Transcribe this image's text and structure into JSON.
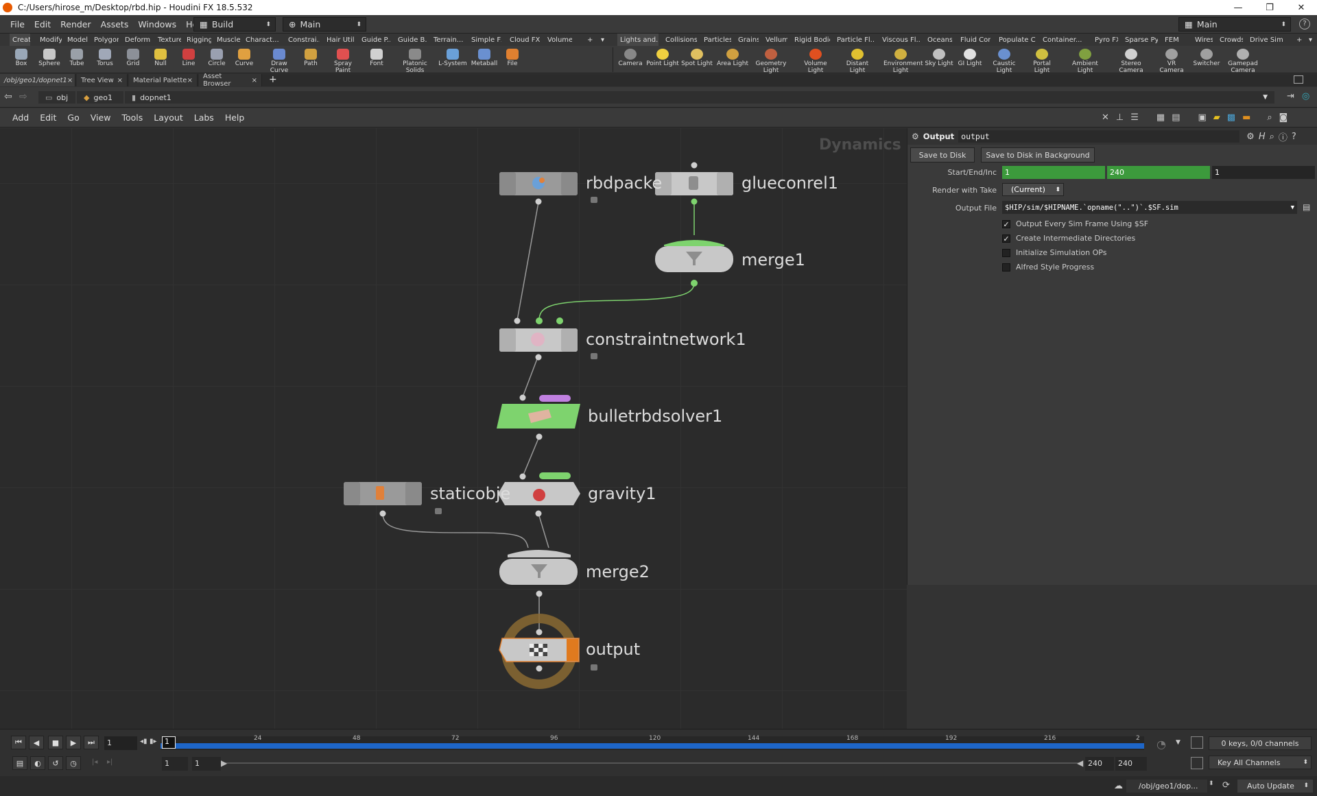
{
  "window": {
    "title": "C:/Users/hirose_m/Desktop/rbd.hip - Houdini FX 18.5.532",
    "minimize": "—",
    "maximize": "❐",
    "close": "✕"
  },
  "menubar": {
    "items": [
      "File",
      "Edit",
      "Render",
      "Assets",
      "Windows",
      "Help"
    ],
    "desktop": "Build",
    "context": "Main",
    "right_desktop": "Main",
    "help_icon": "?"
  },
  "shelf_tabs_left": [
    "Create",
    "Modify",
    "Model",
    "Polygon",
    "Deform",
    "Texture",
    "Rigging",
    "Muscles",
    "Charact...",
    "Constrai...",
    "Hair Utils",
    "Guide P...",
    "Guide B...",
    "Terrain...",
    "Simple FX",
    "Cloud FX",
    "Volume"
  ],
  "shelf_tabs_right": [
    "Lights and...",
    "Collisions",
    "Particles",
    "Grains",
    "Vellum",
    "Rigid Bodies",
    "Particle Fl...",
    "Viscous Fl...",
    "Oceans",
    "Fluid Con...",
    "Populate C...",
    "Container...",
    "Pyro FX",
    "Sparse Pyr...",
    "FEM",
    "Wires",
    "Crowds",
    "Drive Sim..."
  ],
  "tools_left": [
    "Box",
    "Sphere",
    "Tube",
    "Torus",
    "Grid",
    "Null",
    "Line",
    "Circle",
    "Curve",
    "Draw Curve",
    "Path",
    "Spray Paint",
    "Font",
    "Platonic Solids",
    "L-System",
    "Metaball",
    "File"
  ],
  "tools_right": [
    "Camera",
    "Point Light",
    "Spot Light",
    "Area Light",
    "Geometry Light",
    "Volume Light",
    "Distant Light",
    "Environment Light",
    "Sky Light",
    "GI Light",
    "Caustic Light",
    "Portal Light",
    "Ambient Light",
    "Stereo Camera",
    "VR Camera",
    "Switcher",
    "Gamepad Camera"
  ],
  "pane_tabs": [
    "/obj/geo1/dopnet1",
    "Tree View",
    "Material Palette",
    "Asset Browser"
  ],
  "path": [
    "obj",
    "geo1",
    "dopnet1"
  ],
  "network_menu": [
    "Add",
    "Edit",
    "Go",
    "View",
    "Tools",
    "Layout",
    "Labs",
    "Help"
  ],
  "network": {
    "context_label": "Dynamics",
    "nodes": {
      "rbdpacked": "rbdpacke",
      "glueconrel": "glueconrel1",
      "merge1": "merge1",
      "constraintnetwork": "constraintnetwork1",
      "bulletsolver": "bulletrbdsolver1",
      "staticobj": "staticobje",
      "gravity": "gravity1",
      "merge2": "merge2",
      "output": "output"
    }
  },
  "params": {
    "node_type": "Output",
    "node_name": "output",
    "save_to_disk": "Save to Disk",
    "save_bg": "Save to Disk in Background",
    "start_end_inc_label": "Start/End/Inc",
    "start": "1",
    "end": "240",
    "inc": "1",
    "render_take_label": "Render with Take",
    "render_take": "(Current)",
    "output_file_label": "Output File",
    "output_file": "$HIP/sim/$HIPNAME.`opname(\"..\")`.$SF.sim",
    "toggles": [
      {
        "label": "Output Every Sim Frame Using $SF",
        "checked": true
      },
      {
        "label": "Create Intermediate Directories",
        "checked": true
      },
      {
        "label": "Initialize Simulation OPs",
        "checked": false
      },
      {
        "label": "Alfred Style Progress",
        "checked": false
      }
    ]
  },
  "timeline": {
    "current_frame": "1",
    "frame_marker": "1",
    "ticks": [
      "24",
      "48",
      "72",
      "96",
      "120",
      "144",
      "168",
      "192",
      "216",
      "2"
    ],
    "range_start": "1",
    "range_start2": "1",
    "range_end": "240",
    "range_end2": "240",
    "keys_info": "0 keys, 0/0 channels",
    "key_all": "Key All Channels",
    "status_path": "/obj/geo1/dop...",
    "auto_update": "Auto Update"
  }
}
